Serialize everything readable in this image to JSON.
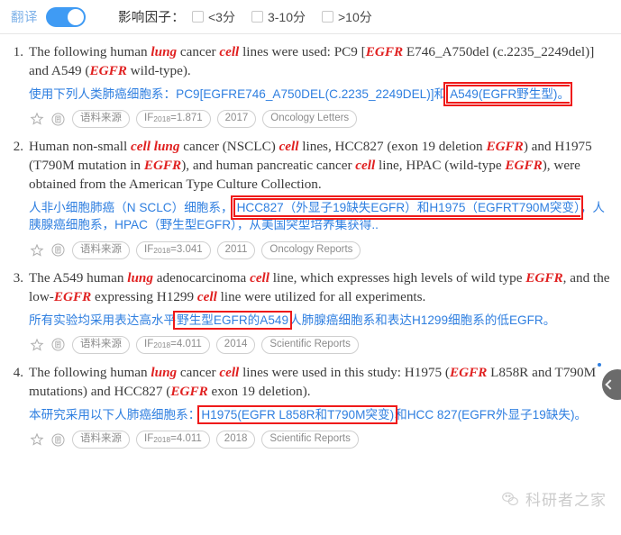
{
  "toolbar": {
    "translate_label": "翻译",
    "translate_on": true,
    "impact_factor_label": "影响因子：",
    "filters": [
      {
        "label": "<3分",
        "checked": false
      },
      {
        "label": "3-10分",
        "checked": false
      },
      {
        "label": ">10分",
        "checked": false
      }
    ]
  },
  "results": [
    {
      "num": "1.",
      "en_parts": [
        {
          "t": "The following human ",
          "kw": false
        },
        {
          "t": "lung",
          "kw": true
        },
        {
          "t": " cancer ",
          "kw": false
        },
        {
          "t": "cell",
          "kw": true
        },
        {
          "t": " lines were used: PC9 [",
          "kw": false
        },
        {
          "t": "EGFR",
          "kw": true
        },
        {
          "t": " E746_A750del (c.2235_2249del)] and A549 (",
          "kw": false
        },
        {
          "t": "EGFR",
          "kw": true
        },
        {
          "t": " wild-type).",
          "kw": false
        }
      ],
      "zh_pre": "使用下列人类肺癌细胞系：PC9[EGFRE746_A750DEL(C.2235_2249DEL)]和",
      "zh_hl": "A549(EGFR野生型)。",
      "zh_post": "",
      "meta": {
        "source": "语料来源",
        "if_prefix": "IF",
        "if_year": "2018",
        "if_value": "=1.871",
        "year": "2017",
        "journal": "Oncology Letters"
      }
    },
    {
      "num": "2.",
      "en_parts": [
        {
          "t": "Human non-small ",
          "kw": false
        },
        {
          "t": "cell lung",
          "kw": true
        },
        {
          "t": " cancer (NSCLC) ",
          "kw": false
        },
        {
          "t": "cell",
          "kw": true
        },
        {
          "t": " lines, HCC827 (exon 19 deletion ",
          "kw": false
        },
        {
          "t": "EGFR",
          "kw": true
        },
        {
          "t": ") and H1975 (T790M mutation in ",
          "kw": false
        },
        {
          "t": "EGFR",
          "kw": true
        },
        {
          "t": "), and human pancreatic cancer ",
          "kw": false
        },
        {
          "t": "cell",
          "kw": true
        },
        {
          "t": " line, HPAC (wild-type ",
          "kw": false
        },
        {
          "t": "EGFR",
          "kw": true
        },
        {
          "t": "), were obtained from the American Type Culture Collection.",
          "kw": false
        }
      ],
      "zh_pre": "人非小细胞肺癌（N SCLC）细胞系，",
      "zh_hl": "HCC827（外显子19缺失EGFR）和H1975（EGFRT790M突变）",
      "zh_post": "，人胰腺癌细胞系，HPAC（野生型EGFR），从美国突型培养集获得..",
      "meta": {
        "source": "语料来源",
        "if_prefix": "IF",
        "if_year": "2018",
        "if_value": "=3.041",
        "year": "2011",
        "journal": "Oncology Reports"
      }
    },
    {
      "num": "3.",
      "en_parts": [
        {
          "t": "The A549 human ",
          "kw": false
        },
        {
          "t": "lung",
          "kw": true
        },
        {
          "t": " adenocarcinoma ",
          "kw": false
        },
        {
          "t": "cell",
          "kw": true
        },
        {
          "t": " line, which expresses high levels of wild type ",
          "kw": false
        },
        {
          "t": "EGFR",
          "kw": true
        },
        {
          "t": ", and the low-",
          "kw": false
        },
        {
          "t": "EGFR",
          "kw": true
        },
        {
          "t": " expressing H1299 ",
          "kw": false
        },
        {
          "t": "cell",
          "kw": true
        },
        {
          "t": " line were utilized for all experiments.",
          "kw": false
        }
      ],
      "zh_pre": "所有实验均采用表达高水平",
      "zh_hl": "野生型EGFR的A549",
      "zh_post": "人肺腺癌细胞系和表达H1299细胞系的低EGFR。",
      "meta": {
        "source": "语料来源",
        "if_prefix": "IF",
        "if_year": "2018",
        "if_value": "=4.011",
        "year": "2014",
        "journal": "Scientific Reports"
      }
    },
    {
      "num": "4.",
      "en_parts": [
        {
          "t": "The following human ",
          "kw": false
        },
        {
          "t": "lung",
          "kw": true
        },
        {
          "t": " cancer ",
          "kw": false
        },
        {
          "t": "cell",
          "kw": true
        },
        {
          "t": " lines were used in this study: H1975 (",
          "kw": false
        },
        {
          "t": "EGFR",
          "kw": true
        },
        {
          "t": " L858R and T790M mutations) and HCC827 (",
          "kw": false
        },
        {
          "t": "EGFR",
          "kw": true
        },
        {
          "t": " exon 19 deletion).",
          "kw": false
        }
      ],
      "zh_pre": "本研究采用以下人肺癌细胞系：",
      "zh_hl": "H1975(EGFR L858R和T790M突变)",
      "zh_post": "和HCC 827(EGFR外显子19缺失)。",
      "meta": {
        "source": "语料来源",
        "if_prefix": "IF",
        "if_year": "2018",
        "if_value": "=4.011",
        "year": "2018",
        "journal": "Scientific Reports"
      }
    }
  ],
  "watermark": {
    "text": "科研者之家"
  },
  "colors": {
    "accent_blue": "#3f9bf4",
    "translation_blue": "#2f7fe0",
    "keyword_red": "#e02020",
    "highlight_red": "#ef1a1a",
    "pill_gray": "#8c8c8c"
  }
}
